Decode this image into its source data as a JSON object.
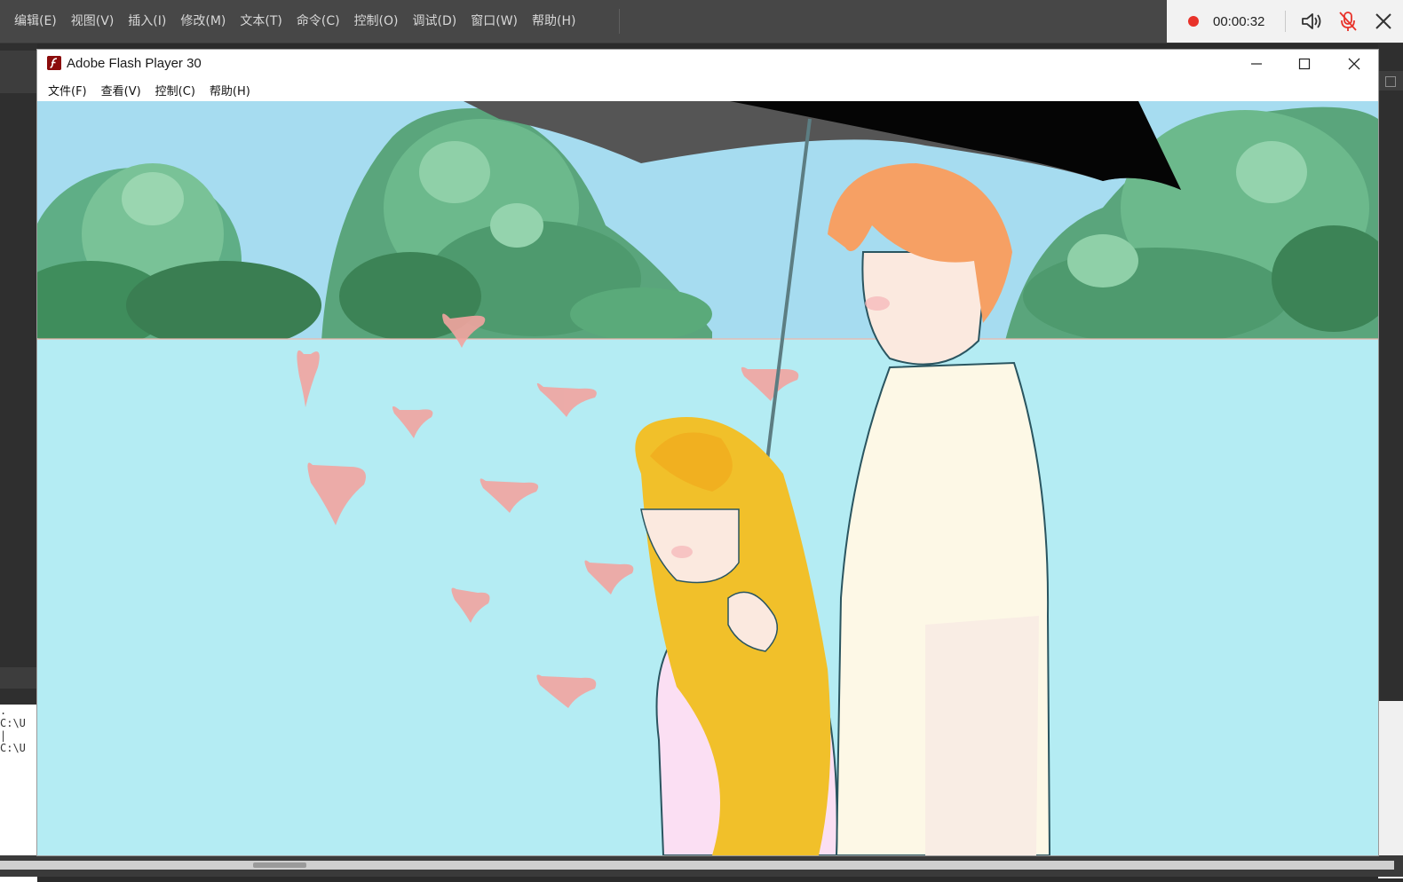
{
  "app_menu": {
    "items": [
      "编辑(E)",
      "视图(V)",
      "插入(I)",
      "修改(M)",
      "文本(T)",
      "命令(C)",
      "控制(O)",
      "调试(D)",
      "窗口(W)",
      "帮助(H)"
    ]
  },
  "recorder": {
    "time": "00:00:32",
    "status_color": "#e8322a"
  },
  "output_panel": {
    "lines": [
      ". C:\\U",
      "| C:\\U"
    ]
  },
  "flash_window": {
    "title": "Adobe Flash Player 30",
    "menu": [
      "文件(F)",
      "查看(V)",
      "控制(C)",
      "帮助(H)"
    ]
  },
  "scene": {
    "sky_color": "#a6dcf0",
    "lake_color": "#b4ecf3",
    "heart_color": "#f2a4a0"
  }
}
